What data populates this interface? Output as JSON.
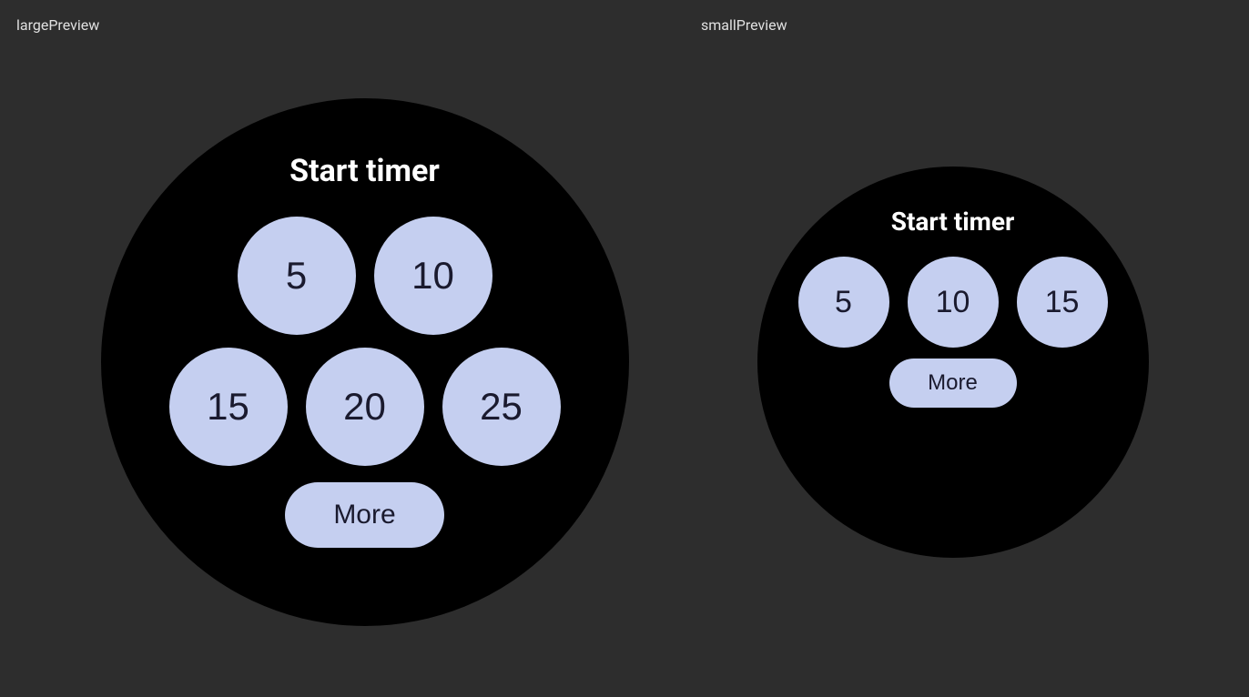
{
  "large_preview": {
    "label": "largePreview",
    "title": "Start timer",
    "buttons": {
      "row1": [
        {
          "value": "5"
        },
        {
          "value": "10"
        }
      ],
      "row2": [
        {
          "value": "15"
        },
        {
          "value": "20"
        },
        {
          "value": "25"
        }
      ],
      "more": "More"
    }
  },
  "small_preview": {
    "label": "smallPreview",
    "title": "Start timer",
    "buttons": {
      "row1": [
        {
          "value": "5"
        },
        {
          "value": "10"
        },
        {
          "value": "15"
        }
      ],
      "more": "More"
    }
  },
  "bg_color": "#2d2d2d",
  "watch_bg": "#000000",
  "btn_bg": "#c5cff0",
  "btn_text_color": "#1a1a2e",
  "title_color": "#ffffff",
  "label_color": "#e0e0e0"
}
